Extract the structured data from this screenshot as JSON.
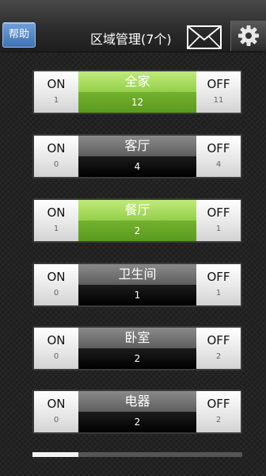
{
  "header": {
    "help_label": "帮助",
    "title": "区域管理(7个)",
    "icons": {
      "mail": "mail-icon",
      "settings": "gear-icon"
    }
  },
  "zones": [
    {
      "name": "全家",
      "on_label": "ON",
      "on_count": "1",
      "total": "12",
      "off_label": "OFF",
      "off_count": "11",
      "state": "active"
    },
    {
      "name": "客厅",
      "on_label": "ON",
      "on_count": "0",
      "total": "4",
      "off_label": "OFF",
      "off_count": "4",
      "state": "inactive"
    },
    {
      "name": "餐厅",
      "on_label": "ON",
      "on_count": "1",
      "total": "2",
      "off_label": "OFF",
      "off_count": "1",
      "state": "active"
    },
    {
      "name": "卫生间",
      "on_label": "ON",
      "on_count": "0",
      "total": "1",
      "off_label": "OFF",
      "off_count": "1",
      "state": "inactive"
    },
    {
      "name": "卧室",
      "on_label": "ON",
      "on_count": "0",
      "total": "2",
      "off_label": "OFF",
      "off_count": "2",
      "state": "inactive"
    },
    {
      "name": "电器",
      "on_label": "ON",
      "on_count": "0",
      "total": "2",
      "off_label": "OFF",
      "off_count": "2",
      "state": "inactive"
    }
  ],
  "colors": {
    "active": "#95cf4a",
    "inactive": "#5e5e5e",
    "help": "#4f80c0"
  },
  "scroll_progress": 0.22
}
